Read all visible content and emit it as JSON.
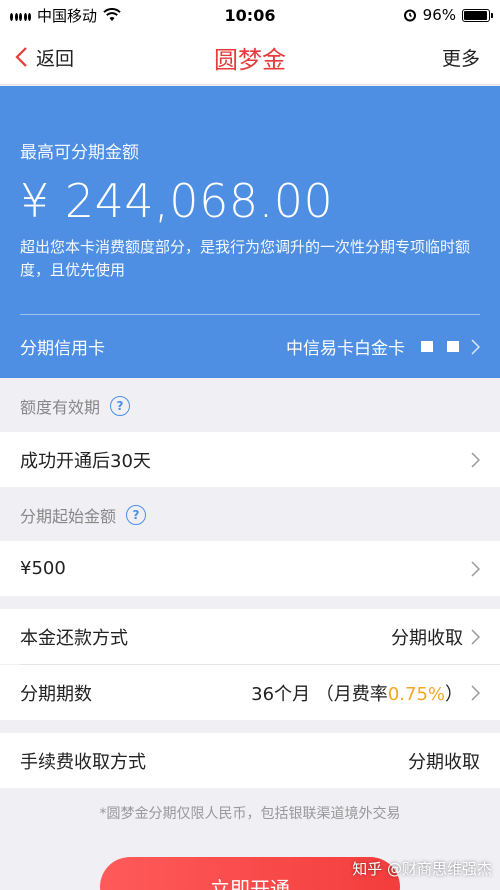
{
  "status_bar": {
    "carrier": "中国移动",
    "time": "10:06",
    "battery": "96%",
    "battery_level": 0.96
  },
  "nav": {
    "back_label": "返回",
    "title": "圆梦金",
    "more_label": "更多"
  },
  "limit_panel": {
    "label": "最高可分期金额",
    "amount": "¥ 244,068.00",
    "description": "超出您本卡消费额度部分，是我行为您调升的一次性分期专项临时额度，且优先使用",
    "card_label": "分期信用卡",
    "card_value": "中信易卡白金卡"
  },
  "validity": {
    "header": "额度有效期",
    "value": "成功开通后30天"
  },
  "min_amount": {
    "header": "分期起始金额",
    "value": "¥500"
  },
  "repayment": {
    "label": "本金还款方式",
    "value": "分期收取"
  },
  "periods": {
    "label": "分期期数",
    "value_prefix": "36个月  （月费率",
    "rate": "0.75%",
    "value_suffix": "）"
  },
  "fee": {
    "label": "手续费收取方式",
    "value": "分期收取"
  },
  "footnote": "*圆梦金分期仅限人民币，包括银联渠道境外交易",
  "action": {
    "button_label": "立即开通"
  },
  "watermark": "知乎 @财商思维强杰",
  "colors": {
    "accent_blue": "#4e8fe4",
    "title_red": "#e83a3a",
    "rate_orange": "#f5a623",
    "button_red": "#f43d3d"
  }
}
